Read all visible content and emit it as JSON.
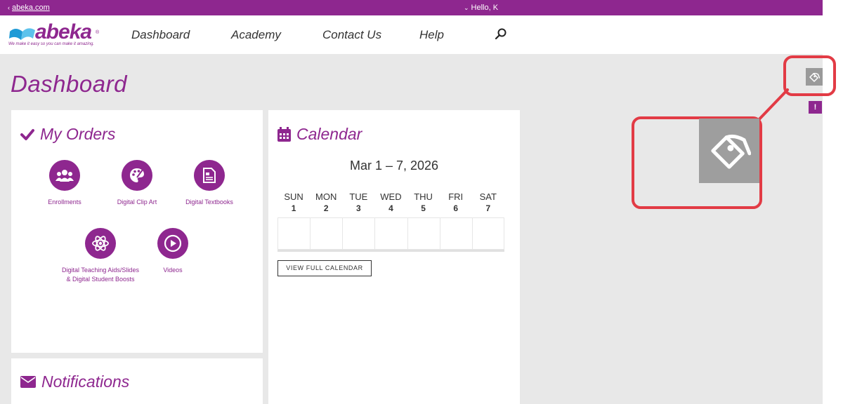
{
  "topbar": {
    "back_chevron": "‹",
    "back_label": "abeka.com",
    "user_chevron": "⌄",
    "user_greeting": "Hello, K"
  },
  "brand": {
    "name": "abeka",
    "registered": "®",
    "tagline": "We make it easy so you can make it amazing.",
    "color": "#8e278f"
  },
  "nav": {
    "items": [
      "Dashboard",
      "Academy",
      "Contact Us",
      "Help"
    ],
    "search_icon": "search-icon"
  },
  "page": {
    "title": "Dashboard"
  },
  "orders": {
    "title": "My Orders",
    "items": [
      {
        "label": "Enrollments",
        "icon": "people-icon"
      },
      {
        "label": "Digital Clip Art",
        "icon": "palette-icon"
      },
      {
        "label": "Digital Textbooks",
        "icon": "document-icon"
      },
      {
        "label": "Digital Teaching Aids/Slides & Digital Student Boosts",
        "icon": "atom-icon"
      },
      {
        "label": "Videos",
        "icon": "play-icon"
      }
    ]
  },
  "calendar": {
    "title": "Calendar",
    "range": "Mar 1 – 7, 2026",
    "days": [
      {
        "name": "SUN",
        "num": "1"
      },
      {
        "name": "MON",
        "num": "2"
      },
      {
        "name": "TUE",
        "num": "3"
      },
      {
        "name": "WED",
        "num": "4"
      },
      {
        "name": "THU",
        "num": "5"
      },
      {
        "name": "FRI",
        "num": "6"
      },
      {
        "name": "SAT",
        "num": "7"
      }
    ],
    "today_index": 2,
    "view_button": "VIEW FULL CALENDAR"
  },
  "notifications": {
    "title": "Notifications"
  },
  "widgets": {
    "feedback_label": "!",
    "highlight_color": "#e23b45"
  }
}
